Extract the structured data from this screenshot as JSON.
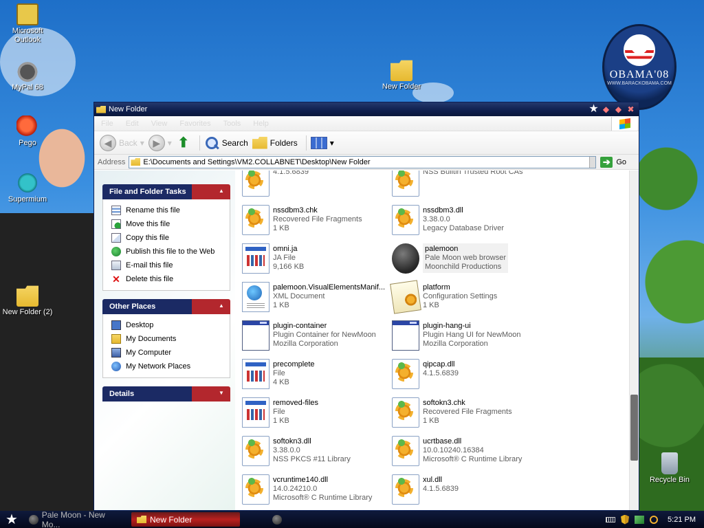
{
  "desktop": {
    "icons": [
      {
        "label": "Microsoft Outlook",
        "icon": "outlook-icon"
      },
      {
        "label": "MyPal 68",
        "icon": "mypal-icon"
      },
      {
        "label": "Pego",
        "icon": "pego-icon"
      },
      {
        "label": "Supermium",
        "icon": "supermium-icon"
      },
      {
        "label": "New Folder (2)",
        "icon": "folder-icon"
      },
      {
        "label": "New Folder",
        "icon": "folder-icon"
      },
      {
        "label": "Recycle Bin",
        "icon": "recycle-bin-icon"
      }
    ],
    "poster": {
      "title": "OBAMA'08",
      "url": "WWW.BARACKOBAMA.COM"
    }
  },
  "window": {
    "title": "New Folder",
    "menu": [
      "File",
      "Edit",
      "View",
      "Favorites",
      "Tools",
      "Help"
    ],
    "toolbar": {
      "back": "Back",
      "search": "Search",
      "folders": "Folders"
    },
    "address": {
      "label": "Address",
      "value": "E:\\Documents and Settings\\VM2.COLLABNET\\Desktop\\New Folder",
      "go": "Go"
    }
  },
  "tasks": {
    "file_tasks": {
      "title": "File and Folder Tasks",
      "items": [
        "Rename this file",
        "Move this file",
        "Copy this file",
        "Publish this file to the Web",
        "E-mail this file",
        "Delete this file"
      ]
    },
    "other_places": {
      "title": "Other Places",
      "items": [
        "Desktop",
        "My Documents",
        "My Computer",
        "My Network Places"
      ]
    },
    "details": {
      "title": "Details"
    }
  },
  "files": [
    {
      "name": "",
      "line2": "4.1.5.6839",
      "line3": "",
      "icon": "dll"
    },
    {
      "name": "",
      "line2": "NSS Builtin Trusted Root CAs",
      "line3": "",
      "icon": "dll"
    },
    {
      "name": "nssdbm3.chk",
      "line2": "Recovered File Fragments",
      "line3": "1 KB",
      "icon": "dll"
    },
    {
      "name": "nssdbm3.dll",
      "line2": "3.38.0.0",
      "line3": "Legacy Database Driver",
      "icon": "dll"
    },
    {
      "name": "omni.ja",
      "line2": "JA File",
      "line3": "9,166 KB",
      "icon": "ja"
    },
    {
      "name": "palemoon",
      "line2": "Pale Moon web browser",
      "line3": "Moonchild Productions",
      "icon": "moon"
    },
    {
      "name": "palemoon.VisualElementsManif...",
      "line2": "XML Document",
      "line3": "1 KB",
      "icon": "xml"
    },
    {
      "name": "platform",
      "line2": "Configuration Settings",
      "line3": "1 KB",
      "icon": "cfg"
    },
    {
      "name": "plugin-container",
      "line2": "Plugin Container for NewMoon",
      "line3": "Mozilla Corporation",
      "icon": "exe"
    },
    {
      "name": "plugin-hang-ui",
      "line2": "Plugin Hang UI for NewMoon",
      "line3": "Mozilla Corporation",
      "icon": "exe"
    },
    {
      "name": "precomplete",
      "line2": "File",
      "line3": "4 KB",
      "icon": "ja"
    },
    {
      "name": "qipcap.dll",
      "line2": "4.1.5.6839",
      "line3": "",
      "icon": "dll"
    },
    {
      "name": "removed-files",
      "line2": "File",
      "line3": "1 KB",
      "icon": "ja"
    },
    {
      "name": "softokn3.chk",
      "line2": "Recovered File Fragments",
      "line3": "1 KB",
      "icon": "dll"
    },
    {
      "name": "softokn3.dll",
      "line2": "3.38.0.0",
      "line3": "NSS PKCS #11 Library",
      "icon": "dll"
    },
    {
      "name": "ucrtbase.dll",
      "line2": "10.0.10240.16384",
      "line3": "Microsoft® C Runtime Library",
      "icon": "dll"
    },
    {
      "name": "vcruntime140.dll",
      "line2": "14.0.24210.0",
      "line3": "Microsoft® C Runtime Library",
      "icon": "dll"
    },
    {
      "name": "xul.dll",
      "line2": "4.1.5.6839",
      "line3": "",
      "icon": "dll"
    }
  ],
  "taskbar": {
    "buttons": [
      "Pale Moon - New Mo...",
      "New Folder"
    ],
    "clock": "5:21 PM"
  }
}
